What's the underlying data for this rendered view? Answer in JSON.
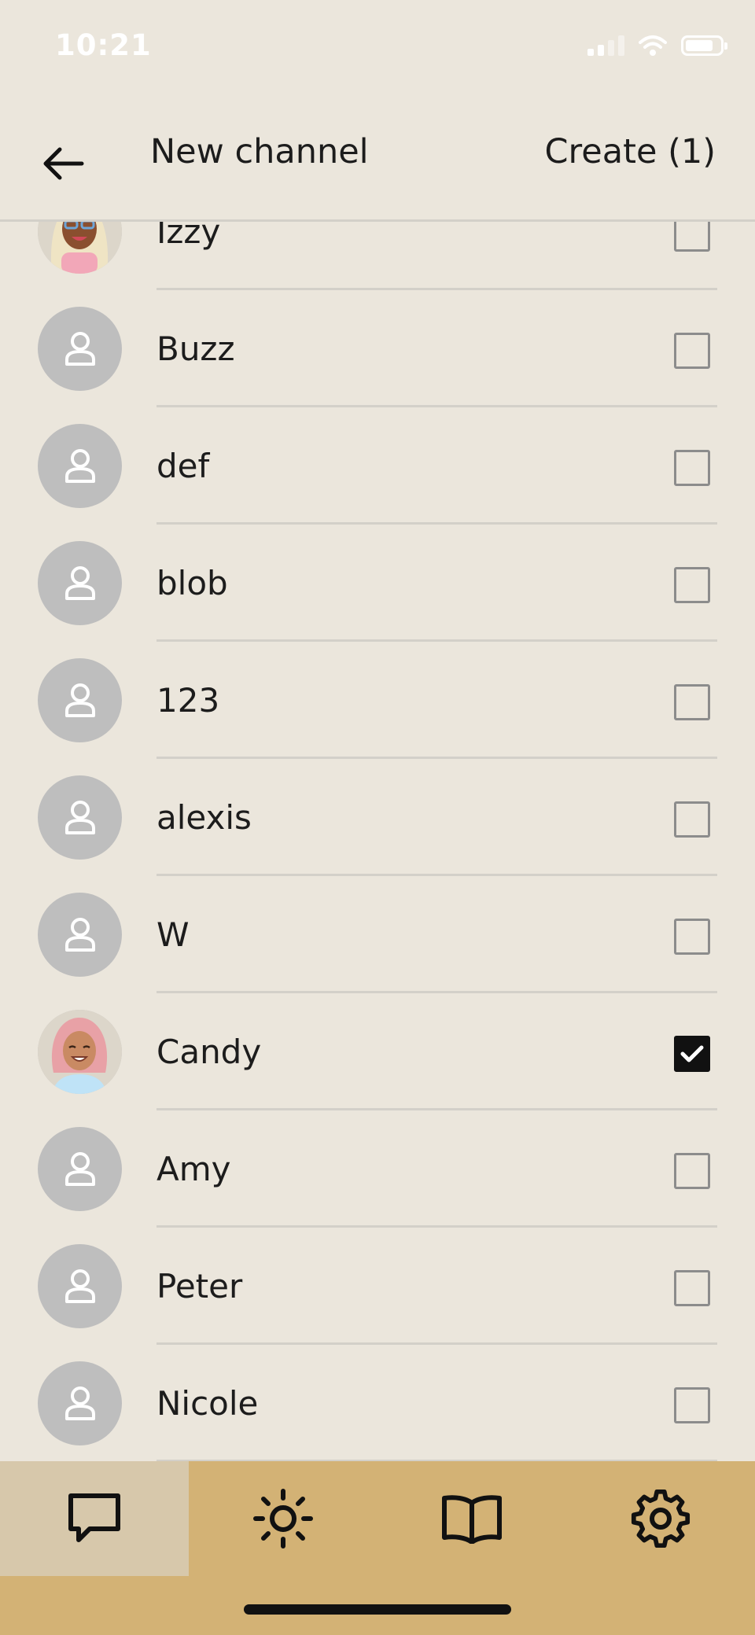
{
  "status_bar": {
    "time": "10:21"
  },
  "header": {
    "title": "New channel",
    "create_label": "Create (1)",
    "back_icon": "arrow-left-icon"
  },
  "contacts": [
    {
      "name": "Izzy",
      "avatar": "emoji-avatar",
      "checked": false
    },
    {
      "name": "Buzz",
      "avatar": "default-person-icon",
      "checked": false
    },
    {
      "name": "def",
      "avatar": "default-person-icon",
      "checked": false
    },
    {
      "name": "blob",
      "avatar": "default-person-icon",
      "checked": false
    },
    {
      "name": "123",
      "avatar": "default-person-icon",
      "checked": false
    },
    {
      "name": "alexis",
      "avatar": "default-person-icon",
      "checked": false
    },
    {
      "name": "W",
      "avatar": "default-person-icon",
      "checked": false
    },
    {
      "name": "Candy",
      "avatar": "emoji-avatar",
      "checked": true
    },
    {
      "name": "Amy",
      "avatar": "default-person-icon",
      "checked": false
    },
    {
      "name": "Peter",
      "avatar": "default-person-icon",
      "checked": false
    },
    {
      "name": "Nicole",
      "avatar": "default-person-icon",
      "checked": false
    }
  ],
  "tab_bar": {
    "tabs": [
      {
        "icon": "chat-bubble-icon",
        "active": true
      },
      {
        "icon": "sun-icon",
        "active": false
      },
      {
        "icon": "open-book-icon",
        "active": false
      },
      {
        "icon": "gear-icon",
        "active": false
      }
    ]
  },
  "colors": {
    "background": "#ebe6dc",
    "tab_bar": "#d3b275",
    "tab_active": "#d7c8ab",
    "avatar_placeholder": "#bebebe"
  }
}
